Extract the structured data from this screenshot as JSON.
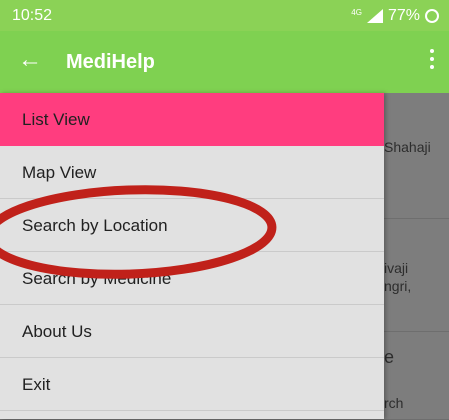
{
  "status_bar": {
    "time": "10:52",
    "network_small": "4G",
    "battery": "77%"
  },
  "app_bar": {
    "title": "MediHelp",
    "back_icon": "arrow-back-icon",
    "more_icon": "more-vert-icon"
  },
  "drawer": {
    "items": [
      {
        "label": "List View",
        "active": true
      },
      {
        "label": "Map View"
      },
      {
        "label": "Search by Location"
      },
      {
        "label": "Search by Medicine"
      },
      {
        "label": "About Us"
      },
      {
        "label": "Exit"
      }
    ]
  },
  "background_list": {
    "snippets": [
      "Shahaji",
      "ivaji",
      "ngri,",
      "e",
      "rch"
    ]
  },
  "colors": {
    "status_bar": "#8bd256",
    "app_bar": "#7fd151",
    "active_item": "#ff3d7f",
    "drawer": "#e1e1e1",
    "annotation": "#c0211a"
  }
}
